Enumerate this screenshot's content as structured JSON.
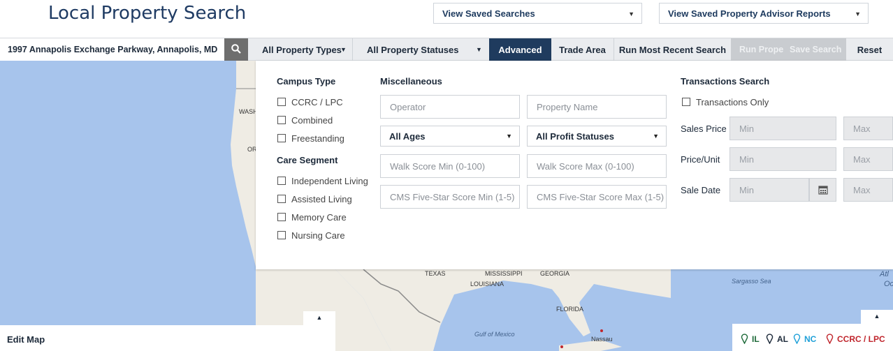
{
  "header": {
    "title": "Local Property Search",
    "saved_searches": "View Saved Searches",
    "saved_reports": "View Saved Property Advisor Reports"
  },
  "searchbar": {
    "address": "1997 Annapolis Exchange Parkway, Annapolis, MD",
    "property_types": "All Property Types",
    "property_statuses": "All Property Statuses",
    "advanced": "Advanced",
    "trade_area": "Trade Area",
    "run_recent": "Run Most Recent Search",
    "run_prope": "Run Prope",
    "save_search": "Save Search",
    "reset": "Reset"
  },
  "panel": {
    "campus_type": {
      "heading": "Campus Type",
      "items": [
        "CCRC / LPC",
        "Combined",
        "Freestanding"
      ]
    },
    "care_segment": {
      "heading": "Care Segment",
      "items": [
        "Independent Living",
        "Assisted Living",
        "Memory Care",
        "Nursing Care"
      ]
    },
    "misc": {
      "heading": "Miscellaneous",
      "operator_ph": "Operator",
      "property_name_ph": "Property Name",
      "ages": "All Ages",
      "profit": "All Profit Statuses",
      "walk_min_ph": "Walk Score Min (0-100)",
      "walk_max_ph": "Walk Score Max (0-100)",
      "cms_min_ph": "CMS Five-Star Score Min (1-5)",
      "cms_max_ph": "CMS Five-Star Score Max (1-5)"
    },
    "transactions": {
      "heading": "Transactions Search",
      "only_label": "Transactions Only",
      "sales_price": "Sales Price",
      "price_unit": "Price/Unit",
      "sale_date": "Sale Date",
      "min_ph": "Min",
      "max_ph": "Max"
    }
  },
  "map": {
    "labels": [
      "WASH",
      "OR",
      "TEXAS",
      "MISSISSIPPI",
      "GEORGIA",
      "LOUISIANA",
      "FLORIDA",
      "Nassau"
    ],
    "seas": [
      "Gulf of Mexico",
      "Sargasso Sea",
      "Atl",
      "Oc"
    ]
  },
  "footer": {
    "edit_map": "Edit Map",
    "legend": [
      {
        "label": "IL",
        "color": "#1f6b3a"
      },
      {
        "label": "AL",
        "color": "#1d2a3a"
      },
      {
        "label": "NC",
        "color": "#1fa0d8"
      },
      {
        "label": "CCRC / LPC",
        "color": "#c0262d"
      }
    ]
  }
}
